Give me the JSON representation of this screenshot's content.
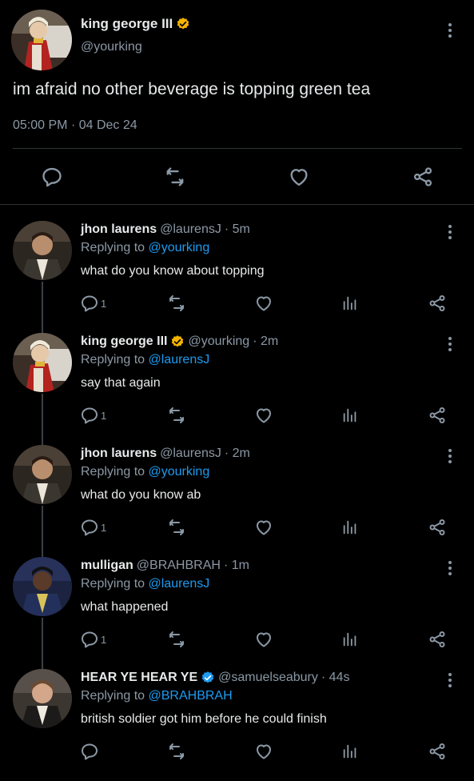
{
  "main_tweet": {
    "name": "king george III",
    "handle": "@yourking",
    "text": "im afraid no other beverage is topping green tea",
    "time": "05:00 PM",
    "date": "04 Dec 24",
    "sep": "·"
  },
  "replies": [
    {
      "name": "jhon laurens",
      "handle": "@laurensJ",
      "age": "· 5m",
      "replying_prefix": "Replying to",
      "replying_to": "@yourking",
      "text": "what do you know about topping",
      "reply_count": "1",
      "verified": false
    },
    {
      "name": "king george III",
      "handle": "@yourking",
      "age": "· 2m",
      "replying_prefix": "Replying to",
      "replying_to": "@laurensJ",
      "text": "say that again",
      "reply_count": "1",
      "verified": true
    },
    {
      "name": "jhon laurens",
      "handle": "@laurensJ",
      "age": "· 2m",
      "replying_prefix": "Replying to",
      "replying_to": "@yourking",
      "text": "what do you know ab",
      "reply_count": "1",
      "verified": false
    },
    {
      "name": "mulligan",
      "handle": "@BRAHBRAH",
      "age": "· 1m",
      "replying_prefix": "Replying to",
      "replying_to": "@laurensJ",
      "text": "what happened",
      "reply_count": "1",
      "verified": false
    },
    {
      "name": "HEAR YE HEAR YE",
      "handle": "@samuelseabury",
      "age": "· 44s",
      "replying_prefix": "Replying to",
      "replying_to": "@BRAHBRAH",
      "text": "british soldier got him before he could finish",
      "reply_count": "",
      "verified": true
    }
  ],
  "icons": {
    "reply": "reply-icon",
    "retweet": "retweet-icon",
    "like": "like-icon",
    "views": "views-icon",
    "share": "share-icon",
    "more": "more-icon",
    "verified_gold": "#f4b400",
    "verified_blue": "#1d9bf0"
  }
}
